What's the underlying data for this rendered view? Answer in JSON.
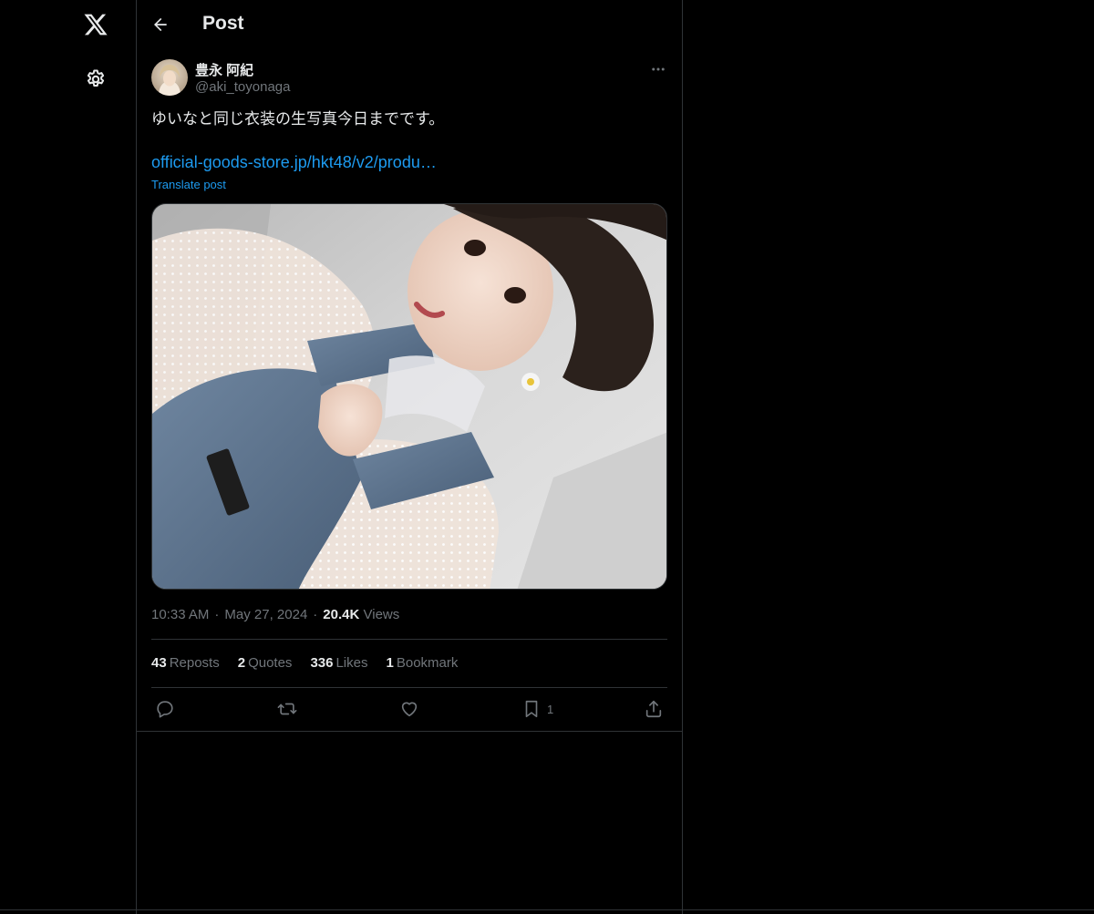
{
  "nav": {
    "logo_icon": "x-logo-icon",
    "settings_icon": "gear-icon"
  },
  "header": {
    "title": "Post",
    "back_icon": "arrow-left-icon"
  },
  "post": {
    "author": {
      "display_name": "豊永 阿紀",
      "handle": "@aki_toyonaga"
    },
    "text": "ゆいなと同じ衣装の生写真今日までです。",
    "link": "official-goods-store.jp/hkt48/v2/produ…",
    "translate_label": "Translate post",
    "time": "10:33 AM",
    "separator": "·",
    "date": "May 27, 2024",
    "views_count": "20.4K",
    "views_label": "Views"
  },
  "stats": {
    "reposts_count": "43",
    "reposts_label": "Reposts",
    "quotes_count": "2",
    "quotes_label": "Quotes",
    "likes_count": "336",
    "likes_label": "Likes",
    "bookmarks_count": "1",
    "bookmarks_label": "Bookmark"
  },
  "actions": {
    "reply_icon": "reply-icon",
    "repost_icon": "repost-icon",
    "like_icon": "heart-icon",
    "bookmark_icon": "bookmark-icon",
    "bookmark_count": "1",
    "share_icon": "share-icon"
  },
  "colors": {
    "background": "#000000",
    "text_primary": "#e7e9ea",
    "text_secondary": "#71767b",
    "link": "#1d9bf0",
    "border": "#2f3336"
  }
}
